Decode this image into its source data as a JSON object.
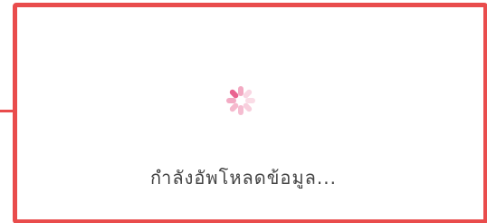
{
  "dialog": {
    "message": "กำลังอัพโหลดข้อมูล..."
  },
  "spinner": {
    "icon": "loading-spinner-icon",
    "color": "#f2a7c1",
    "accent_color": "#e9638f"
  },
  "theme": {
    "border_color": "#e94c4c",
    "text_color": "#444444",
    "background": "#ffffff"
  }
}
